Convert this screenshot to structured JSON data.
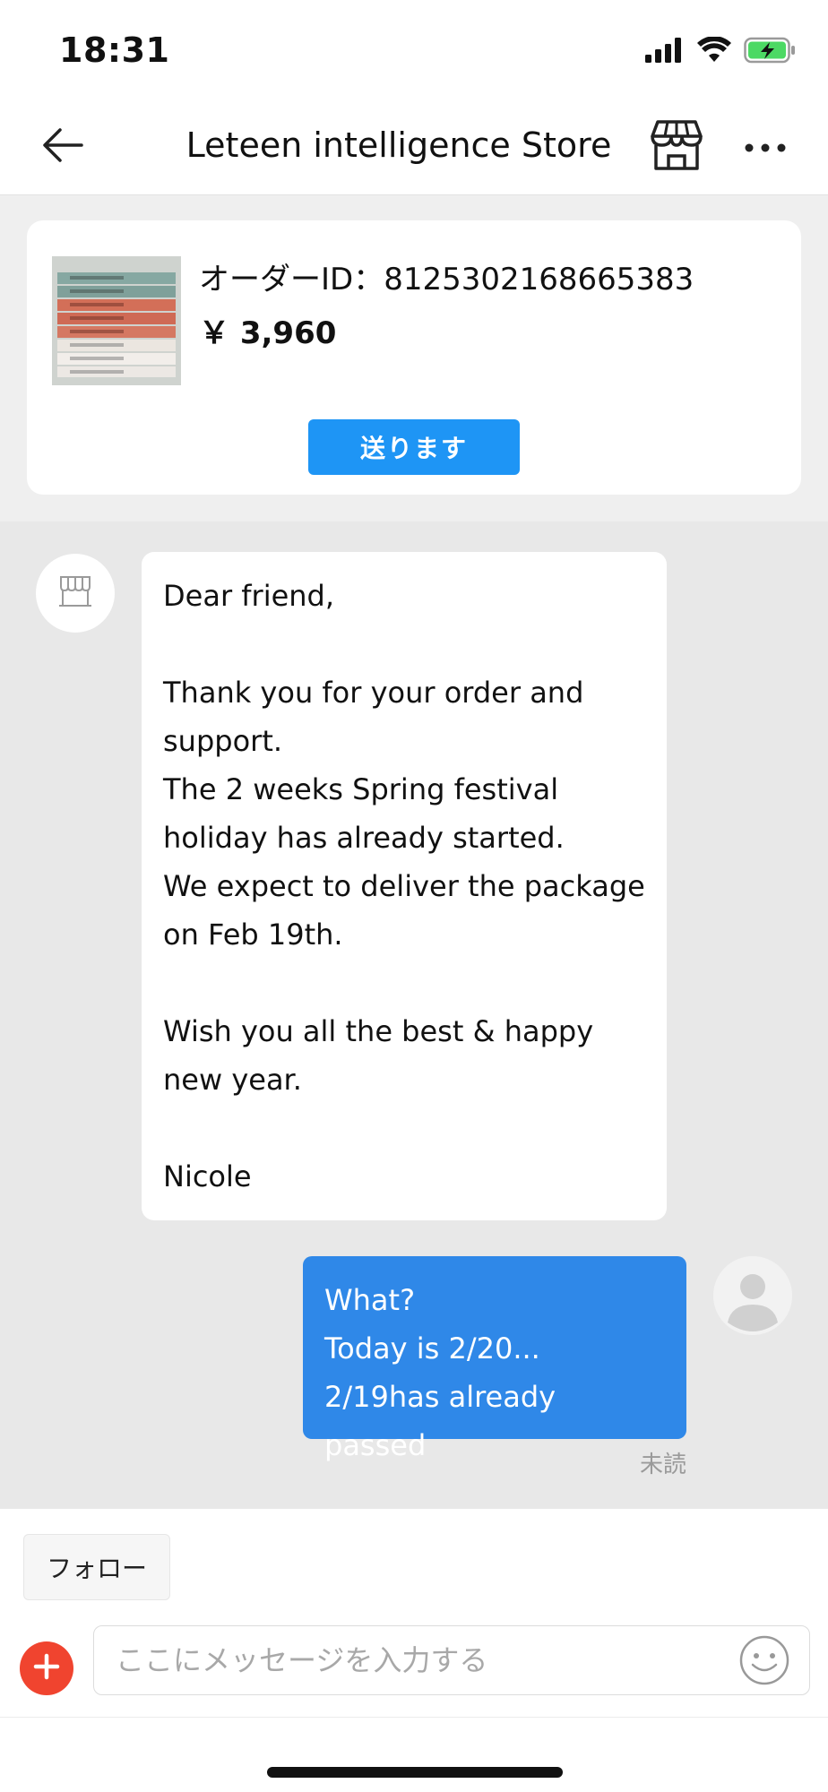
{
  "status_bar": {
    "time": "18:31",
    "icons": [
      "signal-icon",
      "wifi-icon",
      "battery-charging-icon"
    ]
  },
  "header": {
    "title": "Leteen intelligence Store",
    "back_icon": "arrow-left-icon",
    "store_icon": "store-icon",
    "more_icon": "more-horizontal-icon"
  },
  "order": {
    "order_id": "オーダーID：8125302168665383",
    "price": "￥ 3,960",
    "send_button": "送ります"
  },
  "messages": {
    "incoming": {
      "lines": [
        "Dear friend,",
        "",
        "Thank you for your order and",
        "support.",
        "The 2 weeks Spring festival",
        "holiday has already started.",
        "We expect to deliver the package",
        "on Feb 19th.",
        "",
        "Wish you all the best & happy",
        "new year.",
        "",
        "Nicole"
      ]
    },
    "outgoing": {
      "lines": [
        "What?",
        "Today is 2/20...",
        "2/19has already passed"
      ]
    },
    "read_status": "未読"
  },
  "bottom": {
    "follow_button": "フォロー",
    "input_placeholder": "ここにメッセージを入力する",
    "add_icon": "plus-icon",
    "emoji_icon": "smile-icon"
  },
  "colors": {
    "accent": "#1e95f5",
    "outgoing_bubble": "#2f88e8",
    "add_button": "#f0442f",
    "battery": "#4cd964"
  }
}
